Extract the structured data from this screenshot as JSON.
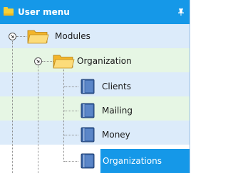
{
  "panel": {
    "title": "User menu"
  },
  "tree": {
    "modules": {
      "label": "Modules"
    },
    "organization": {
      "label": "Organization"
    },
    "items": [
      {
        "label": "Clients"
      },
      {
        "label": "Mailing"
      },
      {
        "label": "Money"
      },
      {
        "label": "Organizations",
        "selected": true
      }
    ]
  },
  "colors": {
    "accent": "#1598e8",
    "row_blue": "#dcebfa",
    "row_green": "#e6f6e4"
  }
}
